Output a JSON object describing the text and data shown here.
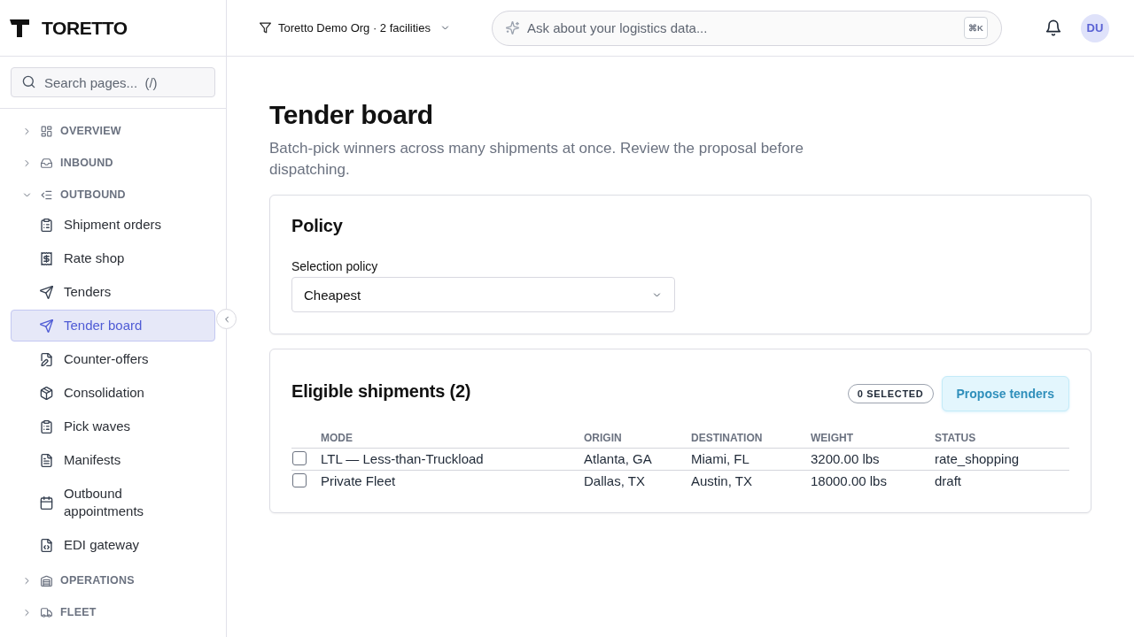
{
  "sidebar": {
    "brand": "TORETTO",
    "search": {
      "placeholder": "Search pages...  (/)"
    },
    "sections": [
      {
        "label": "OVERVIEW",
        "expanded": false
      },
      {
        "label": "INBOUND",
        "expanded": false
      },
      {
        "label": "OUTBOUND",
        "expanded": true,
        "children": [
          {
            "label": "Shipment orders",
            "selected": false
          },
          {
            "label": "Rate shop",
            "selected": false
          },
          {
            "label": "Tenders",
            "selected": false
          },
          {
            "label": "Tender board",
            "selected": true
          },
          {
            "label": "Counter-offers",
            "selected": false
          },
          {
            "label": "Consolidation",
            "selected": false
          },
          {
            "label": "Pick waves",
            "selected": false
          },
          {
            "label": "Manifests",
            "selected": false
          },
          {
            "label": "Outbound appointments",
            "selected": false
          },
          {
            "label": "EDI gateway",
            "selected": false
          }
        ]
      },
      {
        "label": "OPERATIONS",
        "expanded": false
      },
      {
        "label": "FLEET",
        "expanded": false
      }
    ]
  },
  "topbar": {
    "org_filter": "Toretto Demo Org · 2 facilities",
    "ask": {
      "placeholder": "Ask about your logistics data...",
      "shortcut": "⌘K"
    },
    "avatar": "DU"
  },
  "page": {
    "title": "Tender board",
    "subtitle": "Batch-pick winners across many shipments at once. Review the proposal before dispatching."
  },
  "policy_card": {
    "title": "Policy",
    "field": {
      "label": "Selection policy",
      "value": "Cheapest"
    }
  },
  "shipments_card": {
    "title": "Eligible shipments (2)",
    "selected_badge": "0 SELECTED",
    "action": {
      "label": "Propose tenders",
      "disabled": true
    },
    "table": {
      "columns": [
        "MODE",
        "ORIGIN",
        "DESTINATION",
        "WEIGHT",
        "STATUS"
      ],
      "rows": [
        {
          "checked": false,
          "cells": [
            "LTL — Less-than-Truckload",
            "Atlanta, GA",
            "Miami, FL",
            "3200.00 lbs",
            "rate_shopping"
          ]
        },
        {
          "checked": false,
          "cells": [
            "Private Fleet",
            "Dallas, TX",
            "Austin, TX",
            "18000.00 lbs",
            "draft"
          ]
        }
      ]
    }
  }
}
